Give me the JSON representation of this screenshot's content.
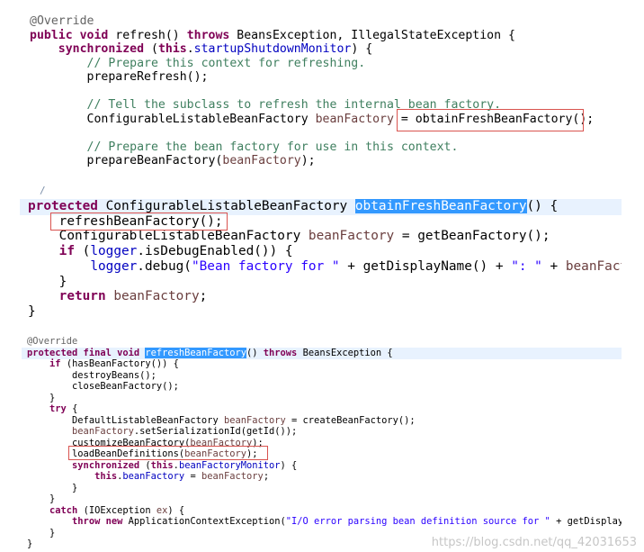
{
  "panel1": {
    "lines": [
      [
        {
          "c": "ann",
          "t": "@Override"
        }
      ],
      [
        {
          "c": "kw",
          "t": "public void "
        },
        {
          "c": "",
          "t": "refresh() "
        },
        {
          "c": "kw",
          "t": "throws "
        },
        {
          "c": "",
          "t": "BeansException, IllegalStateException {"
        }
      ],
      [
        {
          "c": "",
          "t": "    "
        },
        {
          "c": "kw",
          "t": "synchronized "
        },
        {
          "c": "",
          "t": "("
        },
        {
          "c": "kw",
          "t": "this"
        },
        {
          "c": "",
          "t": "."
        },
        {
          "c": "fld",
          "t": "startupShutdownMonitor"
        },
        {
          "c": "",
          "t": ") {"
        }
      ],
      [
        {
          "c": "",
          "t": "        "
        },
        {
          "c": "cm",
          "t": "// Prepare this context for refreshing."
        }
      ],
      [
        {
          "c": "",
          "t": "        prepareRefresh();"
        }
      ],
      [],
      [
        {
          "c": "",
          "t": "        "
        },
        {
          "c": "cm",
          "t": "// Tell the subclass to refresh the internal bean factory."
        }
      ],
      [
        {
          "c": "",
          "t": "        ConfigurableListableBeanFactory "
        },
        {
          "c": "var",
          "t": "beanFactory"
        },
        {
          "c": "",
          "t": " = obtainFreshBeanFactory();"
        }
      ],
      [],
      [
        {
          "c": "",
          "t": "        "
        },
        {
          "c": "cm",
          "t": "// Prepare the bean factory for use in this context."
        }
      ],
      [
        {
          "c": "",
          "t": "        prepareBeanFactory("
        },
        {
          "c": "var",
          "t": "beanFactory"
        },
        {
          "c": "",
          "t": ");"
        }
      ]
    ]
  },
  "panel2": {
    "stub": "/",
    "lines": [
      [
        {
          "c": "kw",
          "t": "protected "
        },
        {
          "c": "",
          "t": "ConfigurableListableBeanFactory "
        },
        {
          "c": "sel",
          "t": "obtainFreshBeanFactory"
        },
        {
          "c": "",
          "t": "() {"
        }
      ],
      [
        {
          "c": "",
          "t": "    refreshBeanFactory();"
        }
      ],
      [
        {
          "c": "",
          "t": "    ConfigurableListableBeanFactory "
        },
        {
          "c": "var",
          "t": "beanFactory"
        },
        {
          "c": "",
          "t": " = getBeanFactory();"
        }
      ],
      [
        {
          "c": "",
          "t": "    "
        },
        {
          "c": "kw",
          "t": "if "
        },
        {
          "c": "",
          "t": "("
        },
        {
          "c": "fld",
          "t": "logger"
        },
        {
          "c": "",
          "t": ".isDebugEnabled()) {"
        }
      ],
      [
        {
          "c": "",
          "t": "        "
        },
        {
          "c": "fld",
          "t": "logger"
        },
        {
          "c": "",
          "t": ".debug("
        },
        {
          "c": "st",
          "t": "\"Bean factory for \""
        },
        {
          "c": "",
          "t": " + getDisplayName() + "
        },
        {
          "c": "st",
          "t": "\": \""
        },
        {
          "c": "",
          "t": " + "
        },
        {
          "c": "var",
          "t": "beanFactory"
        }
      ],
      [
        {
          "c": "",
          "t": "    }"
        }
      ],
      [
        {
          "c": "",
          "t": "    "
        },
        {
          "c": "kw",
          "t": "return "
        },
        {
          "c": "var",
          "t": "beanFactory"
        },
        {
          "c": "",
          "t": ";"
        }
      ],
      [
        {
          "c": "",
          "t": "}"
        }
      ]
    ]
  },
  "panel3": {
    "lines": [
      [
        {
          "c": "ann",
          "t": "@Override"
        }
      ],
      [
        {
          "c": "kw",
          "t": "protected final void "
        },
        {
          "c": "sel",
          "t": "refreshBeanFactory"
        },
        {
          "c": "",
          "t": "() "
        },
        {
          "c": "kw",
          "t": "throws "
        },
        {
          "c": "",
          "t": "BeansException {"
        }
      ],
      [
        {
          "c": "",
          "t": "    "
        },
        {
          "c": "kw",
          "t": "if "
        },
        {
          "c": "",
          "t": "(hasBeanFactory()) {"
        }
      ],
      [
        {
          "c": "",
          "t": "        destroyBeans();"
        }
      ],
      [
        {
          "c": "",
          "t": "        closeBeanFactory();"
        }
      ],
      [
        {
          "c": "",
          "t": "    }"
        }
      ],
      [
        {
          "c": "",
          "t": "    "
        },
        {
          "c": "kw",
          "t": "try "
        },
        {
          "c": "",
          "t": "{"
        }
      ],
      [
        {
          "c": "",
          "t": "        DefaultListableBeanFactory "
        },
        {
          "c": "var",
          "t": "beanFactory"
        },
        {
          "c": "",
          "t": " = createBeanFactory();"
        }
      ],
      [
        {
          "c": "",
          "t": "        "
        },
        {
          "c": "var",
          "t": "beanFactory"
        },
        {
          "c": "",
          "t": ".setSerializationId(getId());"
        }
      ],
      [
        {
          "c": "",
          "t": "        customizeBeanFactory("
        },
        {
          "c": "var",
          "t": "beanFactory"
        },
        {
          "c": "",
          "t": ");"
        }
      ],
      [
        {
          "c": "",
          "t": "        loadBeanDefinitions("
        },
        {
          "c": "var",
          "t": "beanFactory"
        },
        {
          "c": "",
          "t": ");"
        }
      ],
      [
        {
          "c": "",
          "t": "        "
        },
        {
          "c": "kw",
          "t": "synchronized "
        },
        {
          "c": "",
          "t": "("
        },
        {
          "c": "kw",
          "t": "this"
        },
        {
          "c": "",
          "t": "."
        },
        {
          "c": "fld",
          "t": "beanFactoryMonitor"
        },
        {
          "c": "",
          "t": ") {"
        }
      ],
      [
        {
          "c": "",
          "t": "            "
        },
        {
          "c": "kw",
          "t": "this"
        },
        {
          "c": "",
          "t": "."
        },
        {
          "c": "fld",
          "t": "beanFactory"
        },
        {
          "c": "",
          "t": " = "
        },
        {
          "c": "var",
          "t": "beanFactory"
        },
        {
          "c": "",
          "t": ";"
        }
      ],
      [
        {
          "c": "",
          "t": "        }"
        }
      ],
      [
        {
          "c": "",
          "t": "    }"
        }
      ],
      [
        {
          "c": "",
          "t": "    "
        },
        {
          "c": "kw",
          "t": "catch "
        },
        {
          "c": "",
          "t": "(IOException "
        },
        {
          "c": "var",
          "t": "ex"
        },
        {
          "c": "",
          "t": ") {"
        }
      ],
      [
        {
          "c": "",
          "t": "        "
        },
        {
          "c": "kw",
          "t": "throw new "
        },
        {
          "c": "",
          "t": "ApplicationContextException("
        },
        {
          "c": "st",
          "t": "\"I/O error parsing bean definition source for \""
        },
        {
          "c": "",
          "t": " + getDisplayNa"
        }
      ],
      [
        {
          "c": "",
          "t": "    }"
        }
      ],
      [
        {
          "c": "",
          "t": "}"
        }
      ]
    ]
  },
  "watermark": "https://blog.csdn.net/qq_42031653"
}
